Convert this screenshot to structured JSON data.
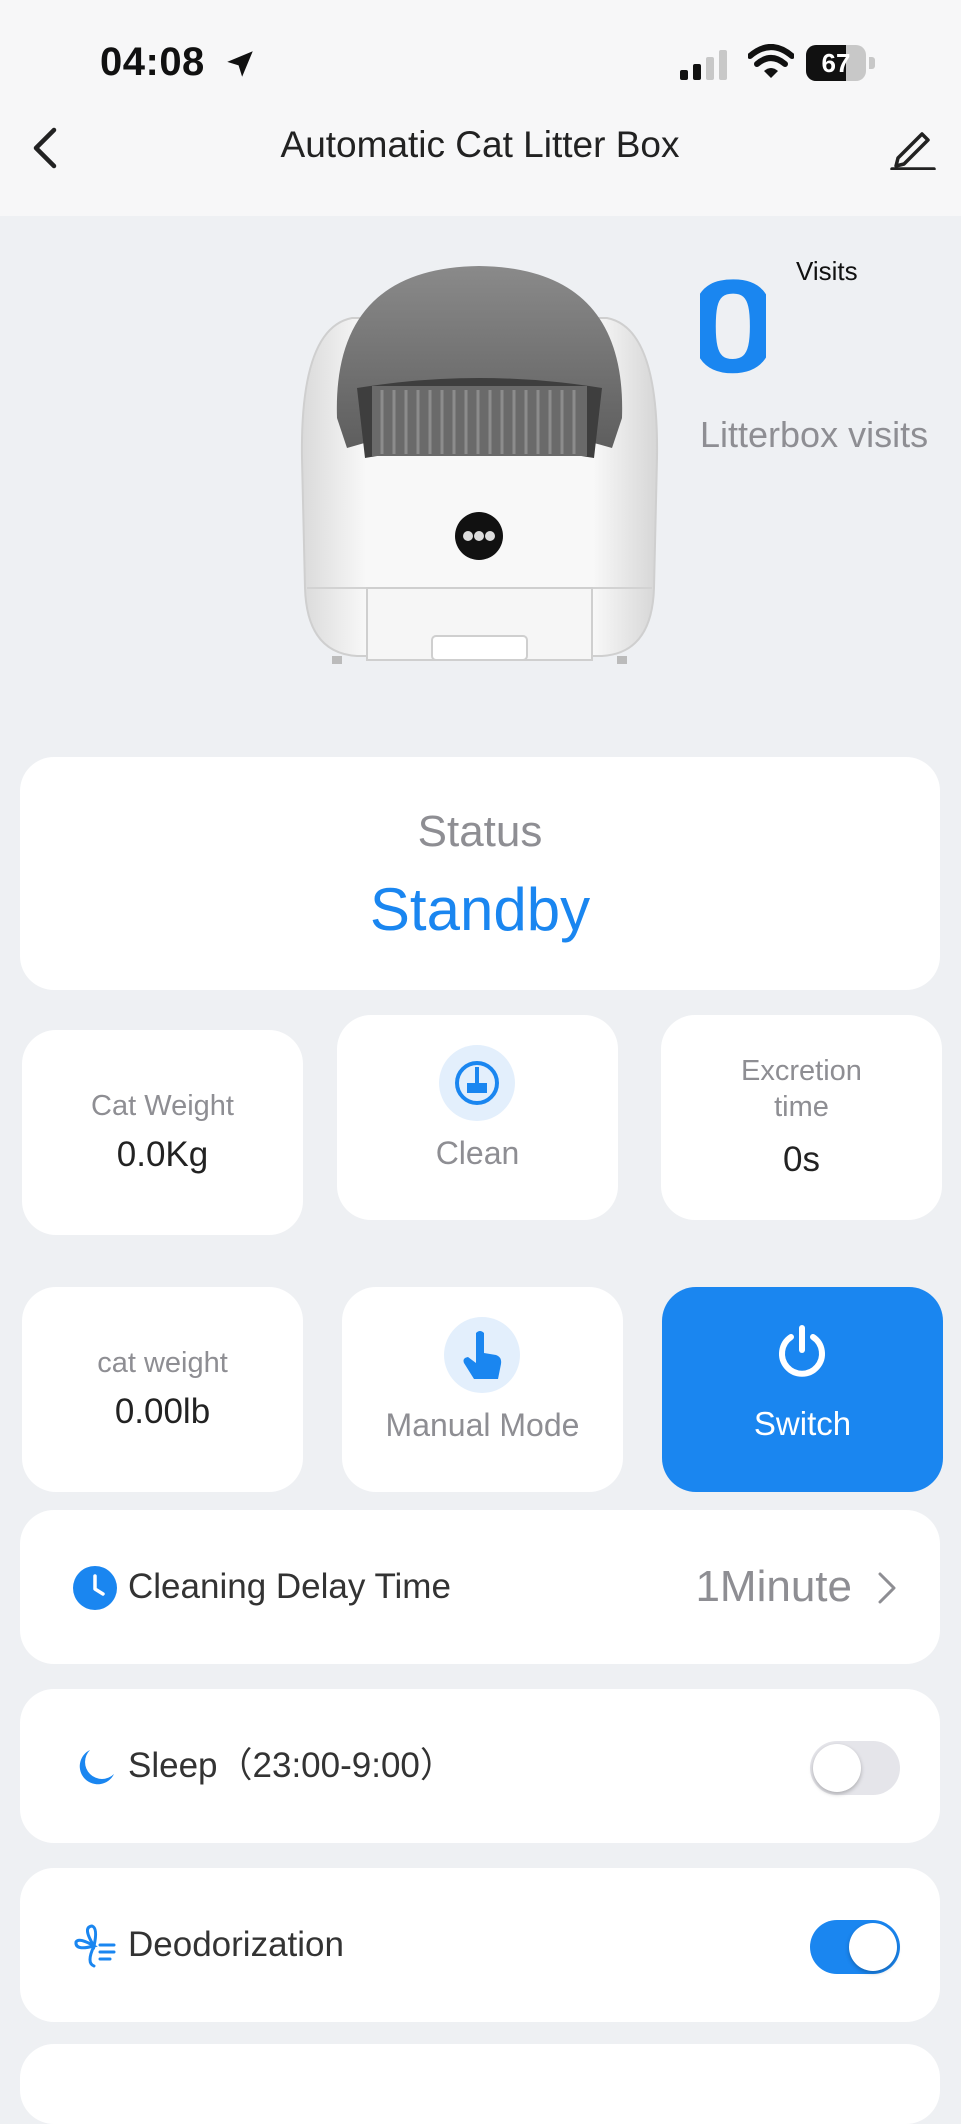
{
  "status_bar": {
    "time": "04:08",
    "battery": "67",
    "battery_percent": 67
  },
  "nav": {
    "title": "Automatic Cat Litter Box"
  },
  "visits": {
    "count": "0",
    "unit_label": "Visits",
    "caption": "Litterbox visits"
  },
  "status": {
    "label": "Status",
    "value": "Standby"
  },
  "tiles": {
    "cat_weight": {
      "label": "Cat Weight",
      "value": "0.0Kg"
    },
    "clean": {
      "label": "Clean"
    },
    "excretion": {
      "label_line1": "Excretion",
      "label_line2": "time",
      "value": "0s"
    },
    "cat_weight_lb": {
      "label": "cat weight",
      "value": "0.00lb"
    },
    "manual": {
      "label": "Manual Mode"
    },
    "switch": {
      "label": "Switch"
    }
  },
  "settings": {
    "cleaning_delay": {
      "label": "Cleaning Delay Time",
      "value": "1Minute"
    },
    "sleep": {
      "label": "Sleep（23:00-9:00）",
      "enabled": false
    },
    "deodorization": {
      "label": "Deodorization",
      "enabled": true
    }
  },
  "colors": {
    "accent": "#1a86f0",
    "background": "#eef0f3",
    "muted_text": "#8e8e93"
  },
  "icons": [
    "location-arrow-icon",
    "signal-icon",
    "wifi-icon",
    "battery-icon",
    "back-chevron-icon",
    "edit-pencil-icon",
    "broom-clean-icon",
    "hand-pointer-icon",
    "power-icon",
    "clock-icon",
    "chevron-right-icon",
    "moon-icon",
    "deodorize-fan-icon"
  ]
}
